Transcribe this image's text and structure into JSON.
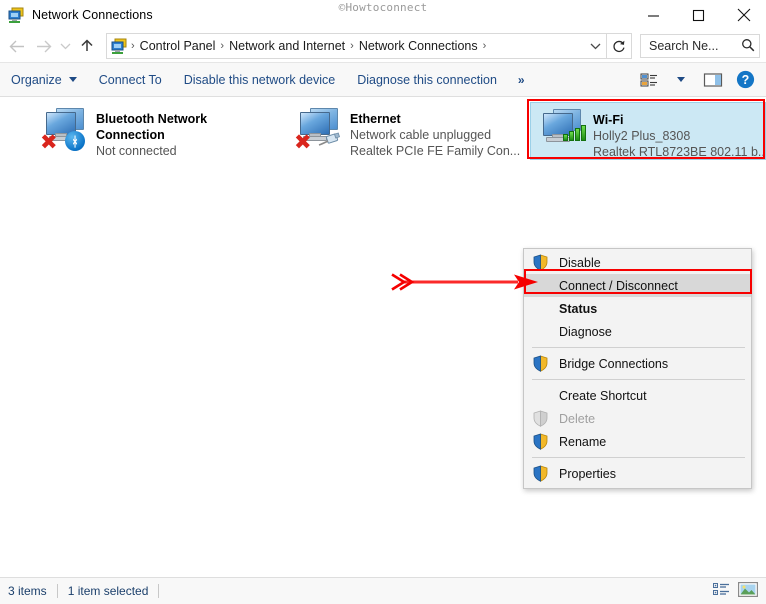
{
  "window": {
    "title": "Network Connections",
    "icon": "network-connections-icon",
    "watermark": "©Howtoconnect",
    "controls": {
      "minimize": "minimize-button",
      "maximize": "maximize-button",
      "close": "close-button"
    }
  },
  "addressbar": {
    "back": "back-arrow",
    "forward": "forward-arrow",
    "recent": "recent-locations-caret",
    "up": "up-arrow",
    "breadcrumbs": [
      "Control Panel",
      "Network and Internet",
      "Network Connections"
    ],
    "separator": "›",
    "dropdown_caret": "chevron-down",
    "refresh": "refresh-icon",
    "search": {
      "value": "Search Ne...",
      "placeholder": "Search Network Connections",
      "icon": "search-icon"
    }
  },
  "commandbar": {
    "items": [
      {
        "label": "Organize",
        "has_caret": true
      },
      {
        "label": "Connect To",
        "has_caret": false
      },
      {
        "label": "Disable this network device",
        "has_caret": false
      },
      {
        "label": "Diagnose this connection",
        "has_caret": false
      }
    ],
    "overflow": "»",
    "right_icons": [
      "change-view-icon",
      "view-dropdown-caret",
      "preview-pane-icon",
      "help-icon"
    ]
  },
  "adapters": [
    {
      "name": "Bluetooth Network Connection",
      "line2": "Not connected",
      "line3": "",
      "badge": "bluetooth-badge",
      "error": true,
      "selected": false
    },
    {
      "name": "Ethernet",
      "line2": "Network cable unplugged",
      "line3": "Realtek PCIe FE Family Con...",
      "badge": "unplugged-cable-badge",
      "error": true,
      "selected": false
    },
    {
      "name": "Wi-Fi",
      "line2": "Holly2 Plus_8308",
      "line3": "Realtek RTL8723BE 802.11 b...",
      "badge": "signal-bars-badge",
      "error": false,
      "selected": true
    }
  ],
  "context_menu": {
    "items": [
      {
        "label": "Disable",
        "shield": true,
        "bold": false,
        "disabled": false,
        "highlighted": false,
        "divider_after": false
      },
      {
        "label": "Connect / Disconnect",
        "shield": false,
        "bold": false,
        "disabled": false,
        "highlighted": true,
        "divider_after": false
      },
      {
        "label": "Status",
        "shield": false,
        "bold": true,
        "disabled": false,
        "highlighted": false,
        "divider_after": false
      },
      {
        "label": "Diagnose",
        "shield": false,
        "bold": false,
        "disabled": false,
        "highlighted": false,
        "divider_after": true
      },
      {
        "label": "Bridge Connections",
        "shield": true,
        "bold": false,
        "disabled": false,
        "highlighted": false,
        "divider_after": true
      },
      {
        "label": "Create Shortcut",
        "shield": false,
        "bold": false,
        "disabled": false,
        "highlighted": false,
        "divider_after": false
      },
      {
        "label": "Delete",
        "shield": true,
        "bold": false,
        "disabled": true,
        "highlighted": false,
        "divider_after": false
      },
      {
        "label": "Rename",
        "shield": true,
        "bold": false,
        "disabled": false,
        "highlighted": false,
        "divider_after": true
      },
      {
        "label": "Properties",
        "shield": true,
        "bold": false,
        "disabled": false,
        "highlighted": false,
        "divider_after": false
      }
    ]
  },
  "annotations": {
    "accent_color": "#f70000",
    "arrow": "red-arrow-pointing-right",
    "boxes": [
      "wifi-adapter-highlight-box",
      "connect-disconnect-highlight-box"
    ]
  },
  "statusbar": {
    "items_count": "3 items",
    "selection": "1 item selected",
    "view_icons": [
      "details-view-icon",
      "large-icons-view-icon"
    ]
  }
}
